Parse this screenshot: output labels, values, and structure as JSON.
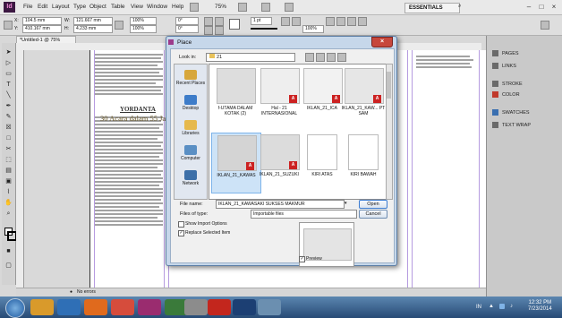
{
  "app": {
    "logo": "Id",
    "menus": [
      "File",
      "Edit",
      "Layout",
      "Type",
      "Object",
      "Table",
      "View",
      "Window",
      "Help"
    ],
    "zoom": "75%",
    "workspace": "ESSENTIALS",
    "window_controls": [
      "–",
      "□",
      "×"
    ]
  },
  "controlbar": {
    "x": "104.5 mm",
    "y": "410.167 mm",
    "w": "121.667 mm",
    "h": "4.233 mm",
    "scale_x": "100%",
    "scale_y": "100%",
    "rotate": "0°",
    "shear": "0°",
    "stroke": "1 pt",
    "opacity": "100%"
  },
  "document": {
    "tab": "*Untitled-1 @ 75%",
    "headline1": "YORDANTA",
    "headline2": "30 Acara dalam 55 Ja",
    "status": "No errors"
  },
  "panels": [
    {
      "label": "PAGES",
      "icon": "pages-icon",
      "color": "#6a6a6a"
    },
    {
      "label": "LINKS",
      "icon": "links-icon",
      "color": "#6a6a6a"
    },
    {
      "label": "STROKE",
      "icon": "stroke-icon",
      "color": "#6a6a6a"
    },
    {
      "label": "COLOR",
      "icon": "color-icon",
      "color": "#c0392b"
    },
    {
      "label": "SWATCHES",
      "icon": "swatches-icon",
      "color": "#3a6fb0"
    },
    {
      "label": "TEXT WRAP",
      "icon": "text-wrap-icon",
      "color": "#6a6a6a"
    }
  ],
  "dialog": {
    "title": "Place",
    "close": "×",
    "look_in_label": "Look in:",
    "look_in_value": "21",
    "places": [
      "Recent Places",
      "Desktop",
      "Libraries",
      "Computer",
      "Network"
    ],
    "files": [
      {
        "name": "f-UTAMA DALAM KOTAK (2)",
        "pdf": false
      },
      {
        "name": "Hal - 21 INTERNASIONAL",
        "pdf": true
      },
      {
        "name": "IKLAN_21_ICA",
        "pdf": true
      },
      {
        "name": "IKLAN_21_KAW... PT SAM",
        "pdf": true
      },
      {
        "name": "IKLAN_21_KAWAS",
        "pdf": true
      },
      {
        "name": "IKLAN_21_SUZUKI",
        "pdf": true
      },
      {
        "name": "KIRI ATAS",
        "pdf": false
      },
      {
        "name": "KIRI BAWAH",
        "pdf": false
      }
    ],
    "file_name_label": "File name:",
    "file_name_value": "IKLAN_21_KAWASAKI SUKSES MAKMUR",
    "file_type_label": "Files of type:",
    "file_type_value": "Importable files",
    "open_label": "Open",
    "cancel_label": "Cancel",
    "show_import_options": "Show Import Options",
    "replace_selected": "Replace Selected Item",
    "preview_label": "Preview"
  },
  "taskbar": {
    "lang": "IN",
    "time": "12:32 PM",
    "date": "7/23/2014"
  }
}
